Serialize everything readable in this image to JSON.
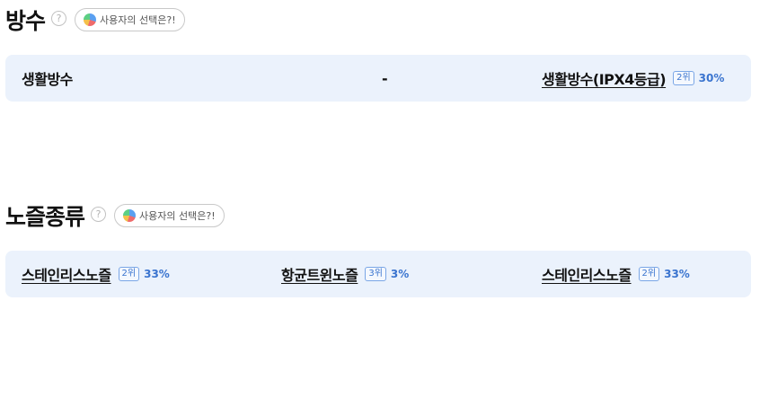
{
  "sections": [
    {
      "title": "방수",
      "help_icon": "?",
      "choice_label": "사용자의 선택은?!",
      "options": [
        {
          "label": "생활방수"
        },
        {
          "label": "-"
        },
        {
          "label": "생활방수(IPX4등급)",
          "rank": "2위",
          "percent": "30%"
        }
      ]
    },
    {
      "title": "노즐종류",
      "help_icon": "?",
      "choice_label": "사용자의 선택은?!",
      "options": [
        {
          "label": "스테인리스노즐",
          "rank": "2위",
          "percent": "33%"
        },
        {
          "label": "항균트윈노즐",
          "rank": "3위",
          "percent": "3%"
        },
        {
          "label": "스테인리스노즐",
          "rank": "2위",
          "percent": "33%"
        }
      ]
    }
  ],
  "colors": {
    "row_bg": "#ebf2fc",
    "accent": "#3a74cf"
  },
  "icons": {
    "help": "help-circle-icon",
    "choice": "pie-chart-icon"
  }
}
